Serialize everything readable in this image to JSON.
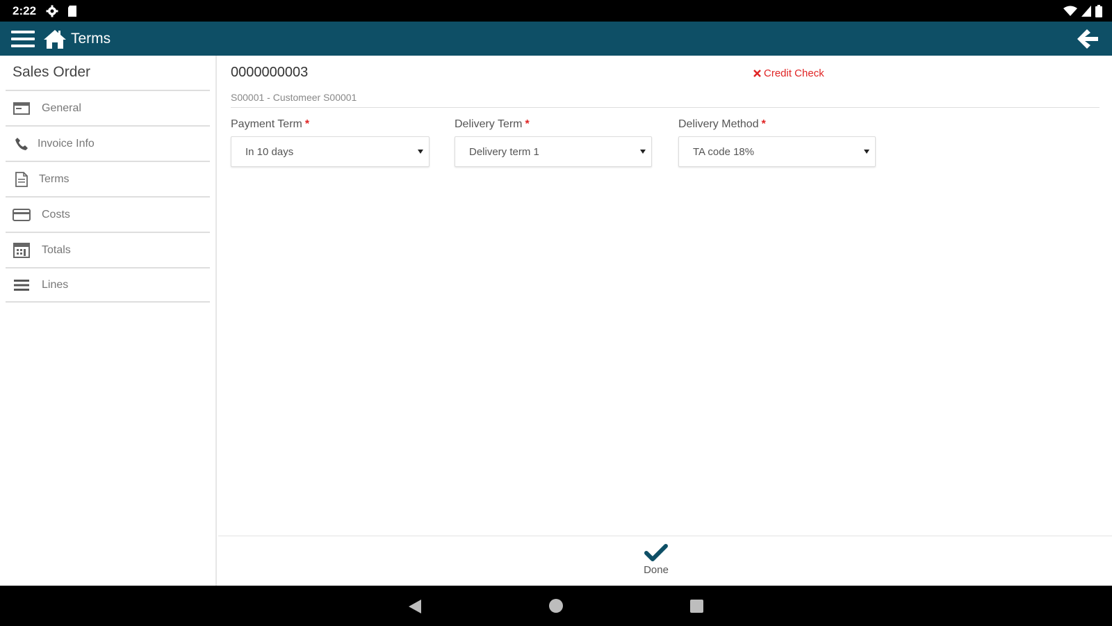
{
  "status_bar": {
    "time": "2:22",
    "icons_left": [
      "gear-icon",
      "sd-card-icon"
    ],
    "icons_right": [
      "wifi-icon",
      "signal-icon",
      "battery-icon"
    ]
  },
  "app_bar": {
    "title": "Terms",
    "color": "#0e4f66",
    "icons": [
      "hamburger-menu-icon",
      "home-icon",
      "back-arrow-icon"
    ]
  },
  "sidebar": {
    "title": "Sales Order",
    "items": [
      {
        "label": "General",
        "icon": "card-icon"
      },
      {
        "label": "Invoice Info",
        "icon": "phone-icon"
      },
      {
        "label": "Terms",
        "icon": "document-icon"
      },
      {
        "label": "Costs",
        "icon": "credit-card-icon"
      },
      {
        "label": "Totals",
        "icon": "calculator-icon"
      },
      {
        "label": "Lines",
        "icon": "list-icon"
      }
    ]
  },
  "order": {
    "number": "0000000003",
    "credit_check": "Credit Check",
    "customer": "S00001 - Customeer S00001"
  },
  "fields": {
    "payment_term": {
      "label": "Payment Term",
      "required": "*",
      "value": "In 10 days"
    },
    "delivery_term": {
      "label": "Delivery Term",
      "required": "*",
      "value": "Delivery term 1"
    },
    "delivery_method": {
      "label": "Delivery Method",
      "required": "*",
      "value": "TA code 18%"
    }
  },
  "footer": {
    "done_label": "Done"
  },
  "colors": {
    "accent": "#0e4f66",
    "error": "#e02424"
  }
}
